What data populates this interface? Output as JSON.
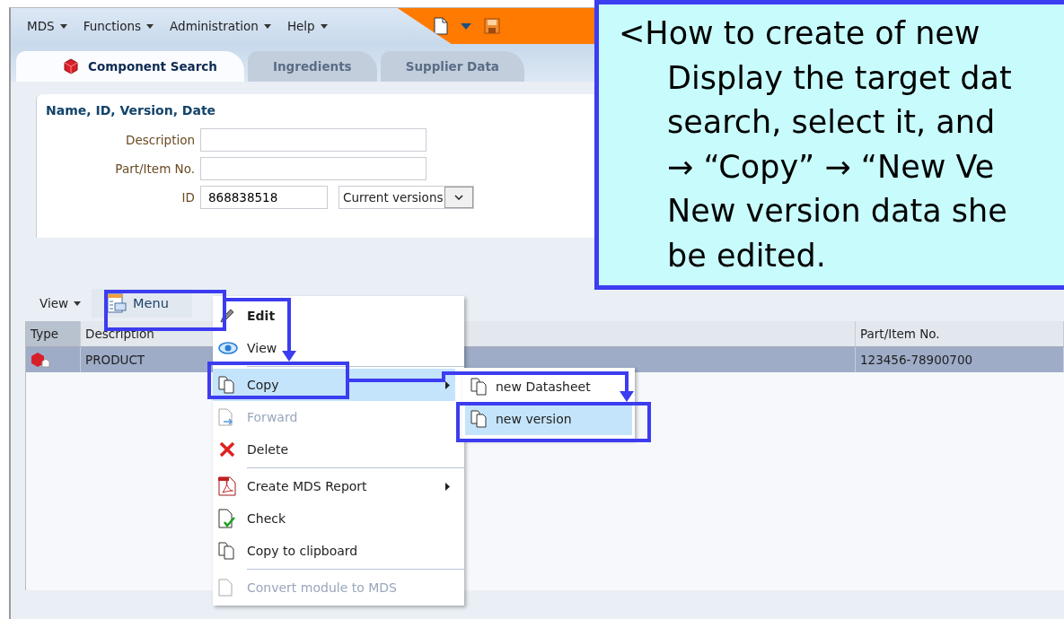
{
  "menu_bar": {
    "items": [
      {
        "label": "MDS"
      },
      {
        "label": "Functions"
      },
      {
        "label": "Administration"
      },
      {
        "label": "Help"
      }
    ]
  },
  "tabs": [
    {
      "label": "Component Search",
      "selected": true
    },
    {
      "label": "Ingredients",
      "selected": false
    },
    {
      "label": "Supplier Data",
      "selected": false
    }
  ],
  "search_panel": {
    "title": "Name, ID, Version, Date",
    "fields": [
      {
        "label": "Description"
      },
      {
        "label": "Part/Item No."
      },
      {
        "label": "ID",
        "value": "868838518",
        "select": "Current versions"
      }
    ]
  },
  "toolbar": {
    "view": "View",
    "menu": "Menu"
  },
  "table": {
    "columns": [
      "Type",
      "Description",
      "Part/Item No."
    ],
    "rows": [
      {
        "description": "PRODUCT",
        "part_no": "123456-78900700",
        "selected": true
      }
    ]
  },
  "context_menu": {
    "items": [
      {
        "kind": "edit",
        "label": "Edit",
        "default": true,
        "disabled": false,
        "selected": false,
        "submenu": false
      },
      {
        "kind": "view",
        "label": "View",
        "default": false,
        "disabled": false,
        "selected": false,
        "submenu": false
      },
      {
        "kind": "separator"
      },
      {
        "kind": "copy",
        "label": "Copy",
        "default": false,
        "disabled": false,
        "selected": true,
        "submenu": true
      },
      {
        "kind": "forward",
        "label": "Forward",
        "default": false,
        "disabled": true,
        "selected": false,
        "submenu": false
      },
      {
        "kind": "delete",
        "label": "Delete",
        "default": false,
        "disabled": false,
        "selected": false,
        "submenu": false
      },
      {
        "kind": "separator"
      },
      {
        "kind": "pdf",
        "label": "Create MDS Report",
        "default": false,
        "disabled": false,
        "selected": false,
        "submenu": true
      },
      {
        "kind": "check",
        "label": "Check",
        "default": false,
        "disabled": false,
        "selected": false,
        "submenu": false
      },
      {
        "kind": "copy",
        "label": "Copy to clipboard",
        "default": false,
        "disabled": false,
        "selected": false,
        "submenu": false
      },
      {
        "kind": "separator"
      },
      {
        "kind": "document",
        "label": "Convert module to MDS",
        "default": false,
        "disabled": true,
        "selected": false,
        "submenu": false
      }
    ]
  },
  "submenu": {
    "items": [
      {
        "label": "new Datasheet",
        "selected": false
      },
      {
        "label": "new version",
        "selected": true
      }
    ]
  },
  "callout": {
    "lines": [
      "<How to create of new",
      "Display the target dat",
      "search, select it, and",
      "→ “Copy” → “New Ve",
      "New version data she",
      "be edited."
    ]
  }
}
